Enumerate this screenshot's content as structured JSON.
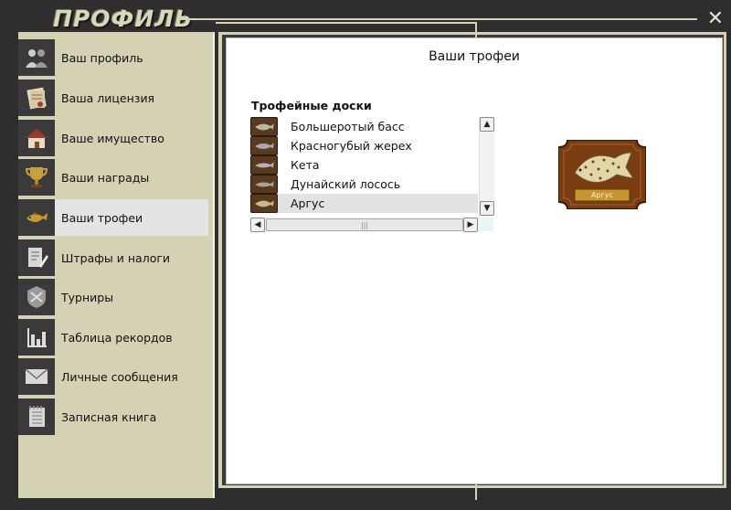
{
  "window": {
    "title": "ПРОФИЛЬ",
    "close_symbol": "✕"
  },
  "sidebar": {
    "items": [
      {
        "label": "Ваш профиль",
        "icon": "people-icon"
      },
      {
        "label": "Ваша лицензия",
        "icon": "license-icon"
      },
      {
        "label": "Ваше имущество",
        "icon": "house-icon"
      },
      {
        "label": "Ваши награды",
        "icon": "trophy-icon"
      },
      {
        "label": "Ваши трофеи",
        "icon": "fish-trophy-icon",
        "active": true
      },
      {
        "label": "Штрафы и налоги",
        "icon": "document-pen-icon"
      },
      {
        "label": "Турниры",
        "icon": "tournament-icon"
      },
      {
        "label": "Таблица рекордов",
        "icon": "bar-chart-icon"
      },
      {
        "label": "Личные сообщения",
        "icon": "envelope-icon"
      },
      {
        "label": "Записная книга",
        "icon": "notebook-icon"
      }
    ]
  },
  "main": {
    "heading": "Ваши трофеи",
    "boards_title": "Трофейные доски",
    "boards": [
      {
        "label": "Большеротый басс"
      },
      {
        "label": "Красногубый жерех"
      },
      {
        "label": "Кета"
      },
      {
        "label": "Дунайский лосось"
      },
      {
        "label": "Аргус",
        "selected": true
      }
    ],
    "scroll_up": "▲",
    "scroll_down": "▼",
    "scroll_left": "◀",
    "scroll_right": "▶",
    "thumb_grip": "|||",
    "plaque": {
      "label": "Аргус"
    }
  },
  "colors": {
    "sidebar_bg": "#d4d2b3",
    "frame": "#2e2e2e",
    "active_item": "#e4e4e4",
    "plaque_wood": "#7a3d12"
  }
}
